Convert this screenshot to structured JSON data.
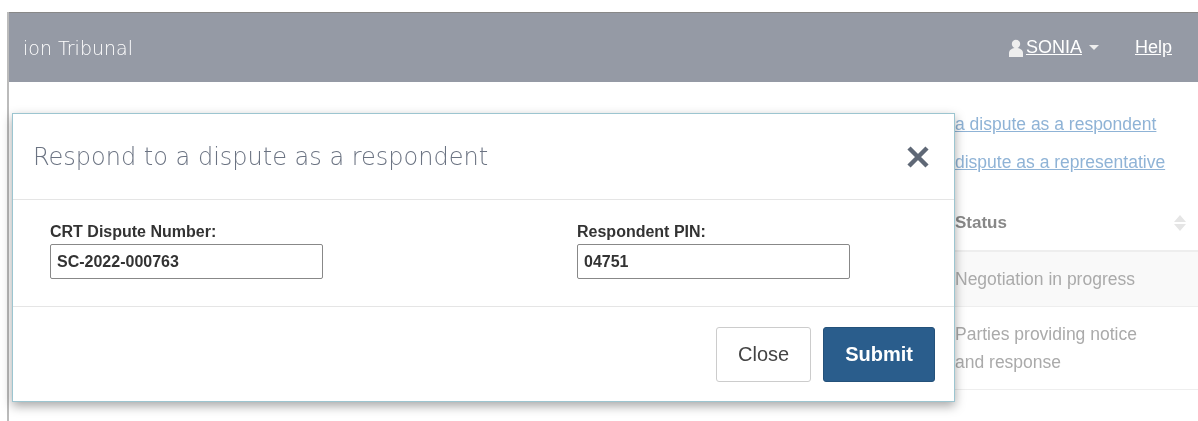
{
  "header": {
    "title": "ion Tribunal",
    "user": "SONIA",
    "help": "Help"
  },
  "side_links": [
    "a dispute as a respondent",
    "dispute as a representative"
  ],
  "table": {
    "columns": [
      "Status"
    ],
    "rows": [
      "Negotiation in progress",
      "Parties providing notice and response"
    ]
  },
  "modal": {
    "title": "Respond to a dispute as a respondent",
    "fields": [
      {
        "label": "CRT Dispute Number:",
        "value": "SC-2022-000763"
      },
      {
        "label": "Respondent PIN:",
        "value": "04751"
      }
    ],
    "buttons": [
      {
        "label": "Close",
        "kind": "secondary"
      },
      {
        "label": "Submit",
        "kind": "primary"
      }
    ]
  }
}
